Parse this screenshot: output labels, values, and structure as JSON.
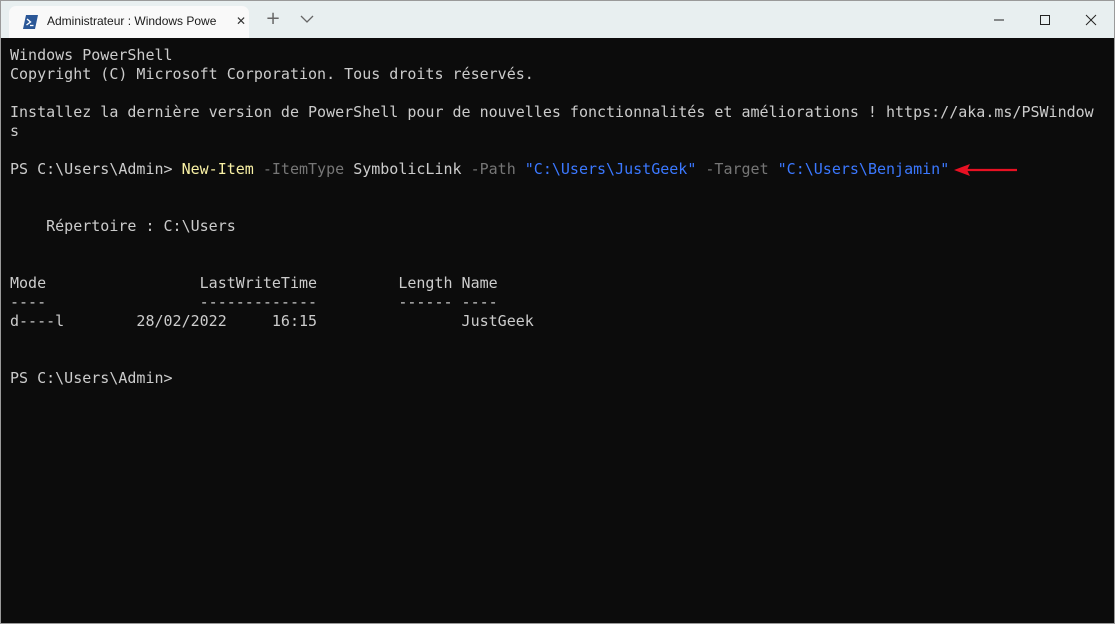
{
  "window": {
    "tab_title": "Administrateur : Windows Powe",
    "tab_icon": "powershell-icon",
    "new_tab_icon": "plus-icon",
    "dropdown_icon": "chevron-down-icon",
    "controls": [
      "minimize-icon",
      "maximize-icon",
      "close-icon"
    ]
  },
  "terminal": {
    "header_line1": "Windows PowerShell",
    "header_line2": "Copyright (C) Microsoft Corporation. Tous droits réservés.",
    "install_line1": "Installez la dernière version de PowerShell pour de nouvelles fonctionnalités et améliorations ! https://aka.ms/PSWindow",
    "install_line2": "s",
    "command": {
      "prompt": "PS C:\\Users\\Admin> ",
      "cmdlet": "New-Item",
      "param1": "-ItemType",
      "value1": "SymbolicLink",
      "param2": "-Path",
      "value2": "\"C:\\Users\\JustGeek\"",
      "param3": "-Target",
      "value3": "\"C:\\Users\\Benjamin\""
    },
    "directory_line": "    Répertoire : C:\\Users",
    "table": {
      "header": "Mode                 LastWriteTime         Length Name",
      "separator": "----                 -------------         ------ ----",
      "row": "d----l        28/02/2022     16:15                JustGeek"
    },
    "final_prompt": "PS C:\\Users\\Admin>"
  },
  "colors": {
    "background": "#0c0c0c",
    "text": "#cccccc",
    "cmdlet": "#f9f1a5",
    "parameter": "#767676",
    "string": "#3b78ff",
    "annotation_arrow": "#e81123"
  },
  "annotation": "red-arrow-icon"
}
